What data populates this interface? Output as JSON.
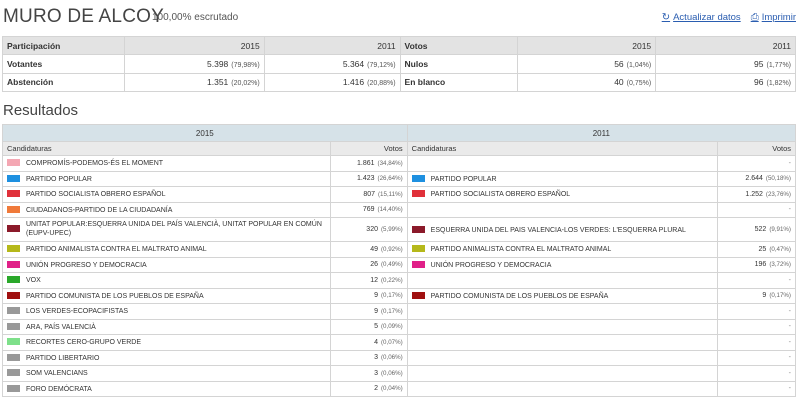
{
  "header": {
    "title": "MURO DE ALCOY",
    "scrutiny": "100,00% escrutado",
    "refresh_label": "Actualizar datos",
    "print_label": "Imprimir"
  },
  "summary": {
    "participation_label": "Participación",
    "votes_label": "Votos",
    "year_a": "2015",
    "year_b": "2011",
    "rows_left": [
      {
        "label": "Votantes",
        "a_val": "5.398",
        "a_pct": "(79,98%)",
        "b_val": "5.364",
        "b_pct": "(79,12%)"
      },
      {
        "label": "Abstención",
        "a_val": "1.351",
        "a_pct": "(20,02%)",
        "b_val": "1.416",
        "b_pct": "(20,88%)"
      }
    ],
    "rows_right": [
      {
        "label": "Nulos",
        "a_val": "56",
        "a_pct": "(1,04%)",
        "b_val": "95",
        "b_pct": "(1,77%)"
      },
      {
        "label": "En blanco",
        "a_val": "40",
        "a_pct": "(0,75%)",
        "b_val": "96",
        "b_pct": "(1,82%)"
      }
    ]
  },
  "results": {
    "title": "Resultados",
    "year_a": "2015",
    "year_b": "2011",
    "candidatures_label": "Candidaturas",
    "votes_label": "Votos",
    "dash": "-",
    "rows": [
      {
        "a_name": "COMPROMÍS-PODEMOS-ÉS EL MOMENT",
        "a_color": "#f4a7b3",
        "a_votes": "1.861",
        "a_pct": "(34,84%)",
        "b_name": "",
        "b_color": "",
        "b_votes": "",
        "b_pct": ""
      },
      {
        "a_name": "PARTIDO POPULAR",
        "a_color": "#1e90e0",
        "a_votes": "1.423",
        "a_pct": "(26,64%)",
        "b_name": "PARTIDO POPULAR",
        "b_color": "#1e90e0",
        "b_votes": "2.644",
        "b_pct": "(50,18%)"
      },
      {
        "a_name": "PARTIDO SOCIALISTA OBRERO ESPAÑOL",
        "a_color": "#e0303a",
        "a_votes": "807",
        "a_pct": "(15,11%)",
        "b_name": "PARTIDO SOCIALISTA OBRERO ESPAÑOL",
        "b_color": "#e0303a",
        "b_votes": "1.252",
        "b_pct": "(23,76%)"
      },
      {
        "a_name": "CIUDADANOS-PARTIDO DE LA CIUDADANÍA",
        "a_color": "#f07a3a",
        "a_votes": "769",
        "a_pct": "(14,40%)",
        "b_name": "",
        "b_color": "",
        "b_votes": "",
        "b_pct": ""
      },
      {
        "a_name": "UNITAT POPULAR:ESQUERRA UNIDA DEL PAÍS VALENCIÀ, UNITAT POPULAR EN COMÚN (EUPV-UPeC)",
        "a_color": "#8b1a2a",
        "a_votes": "320",
        "a_pct": "(5,99%)",
        "b_name": "ESQUERRA UNIDA DEL PAIS VALENCIA-LOS VERDES: L'ESQUERRA PLURAL",
        "b_color": "#8b1a2a",
        "b_votes": "522",
        "b_pct": "(9,91%)"
      },
      {
        "a_name": "PARTIDO ANIMALISTA CONTRA EL MALTRATO ANIMAL",
        "a_color": "#b5b81a",
        "a_votes": "49",
        "a_pct": "(0,92%)",
        "b_name": "PARTIDO ANIMALISTA CONTRA EL MALTRATO ANIMAL",
        "b_color": "#b5b81a",
        "b_votes": "25",
        "b_pct": "(0,47%)"
      },
      {
        "a_name": "UNIÓN PROGRESO Y DEMOCRACIA",
        "a_color": "#e02088",
        "a_votes": "26",
        "a_pct": "(0,49%)",
        "b_name": "UNIÓN PROGRESO Y DEMOCRACIA",
        "b_color": "#e02088",
        "b_votes": "196",
        "b_pct": "(3,72%)"
      },
      {
        "a_name": "VOX",
        "a_color": "#2aa82a",
        "a_votes": "12",
        "a_pct": "(0,22%)",
        "b_name": "",
        "b_color": "",
        "b_votes": "",
        "b_pct": ""
      },
      {
        "a_name": "PARTIDO COMUNISTA DE LOS PUEBLOS DE ESPAÑA",
        "a_color": "#a01010",
        "a_votes": "9",
        "a_pct": "(0,17%)",
        "b_name": "PARTIDO COMUNISTA DE LOS PUEBLOS DE ESPAÑA",
        "b_color": "#a01010",
        "b_votes": "9",
        "b_pct": "(0,17%)"
      },
      {
        "a_name": "LOS VERDES-ECOPACIFISTAS",
        "a_color": "#999999",
        "a_votes": "9",
        "a_pct": "(0,17%)",
        "b_name": "",
        "b_color": "",
        "b_votes": "",
        "b_pct": ""
      },
      {
        "a_name": "ARA, PAÍS VALENCIÀ",
        "a_color": "#999999",
        "a_votes": "5",
        "a_pct": "(0,09%)",
        "b_name": "",
        "b_color": "",
        "b_votes": "",
        "b_pct": ""
      },
      {
        "a_name": "RECORTES CERO-GRUPO VERDE",
        "a_color": "#7ee08a",
        "a_votes": "4",
        "a_pct": "(0,07%)",
        "b_name": "",
        "b_color": "",
        "b_votes": "",
        "b_pct": ""
      },
      {
        "a_name": "PARTIDO LIBERTARIO",
        "a_color": "#999999",
        "a_votes": "3",
        "a_pct": "(0,06%)",
        "b_name": "",
        "b_color": "",
        "b_votes": "",
        "b_pct": ""
      },
      {
        "a_name": "SOM VALENCIANS",
        "a_color": "#999999",
        "a_votes": "3",
        "a_pct": "(0,06%)",
        "b_name": "",
        "b_color": "",
        "b_votes": "",
        "b_pct": ""
      },
      {
        "a_name": "FORO DEMÓCRATA",
        "a_color": "#999999",
        "a_votes": "2",
        "a_pct": "(0,04%)",
        "b_name": "",
        "b_color": "",
        "b_votes": "",
        "b_pct": ""
      }
    ]
  }
}
